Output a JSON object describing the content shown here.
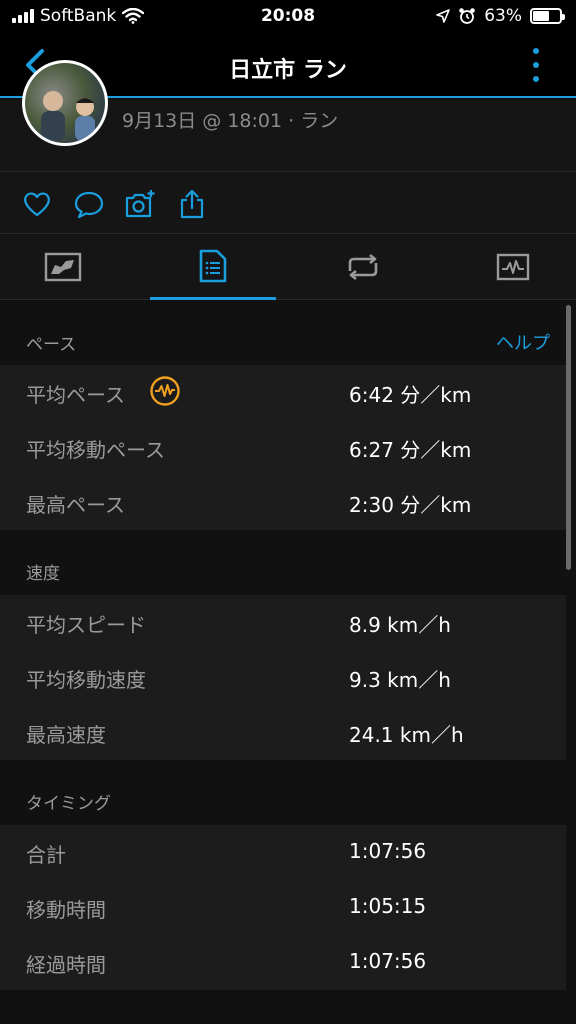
{
  "status_bar": {
    "carrier": "SoftBank",
    "time": "20:08",
    "battery": "63%",
    "battery_level": 0.63
  },
  "navbar": {
    "title": "日立市 ラン"
  },
  "activity": {
    "subtitle": "9月13日 @ 18:01 · ラン"
  },
  "tabs": [
    {
      "name": "tab-overview"
    },
    {
      "name": "tab-stats",
      "active": true
    },
    {
      "name": "tab-laps"
    },
    {
      "name": "tab-charts"
    }
  ],
  "sections": {
    "pace": {
      "label": "ペース",
      "help": "ヘルプ",
      "rows": [
        {
          "label": "平均ペース",
          "value": "6:42 分／km"
        },
        {
          "label": "平均移動ペース",
          "value": "6:27 分／km"
        },
        {
          "label": "最高ペース",
          "value": "2:30 分／km"
        }
      ]
    },
    "speed": {
      "label": "速度",
      "rows": [
        {
          "label": "平均スピード",
          "value": "8.9 km／h"
        },
        {
          "label": "平均移動速度",
          "value": "9.3 km／h"
        },
        {
          "label": "最高速度",
          "value": "24.1 km／h"
        }
      ]
    },
    "timing": {
      "label": "タイミング",
      "rows": [
        {
          "label": "合計",
          "value": "1:07:56"
        },
        {
          "label": "移動時間",
          "value": "1:05:15"
        },
        {
          "label": "経過時間",
          "value": "1:07:56"
        }
      ]
    }
  },
  "colors": {
    "accent": "#1a9ede",
    "badge": "#f0a020",
    "background": "#111111",
    "row_bg": "#1c1c1c"
  }
}
